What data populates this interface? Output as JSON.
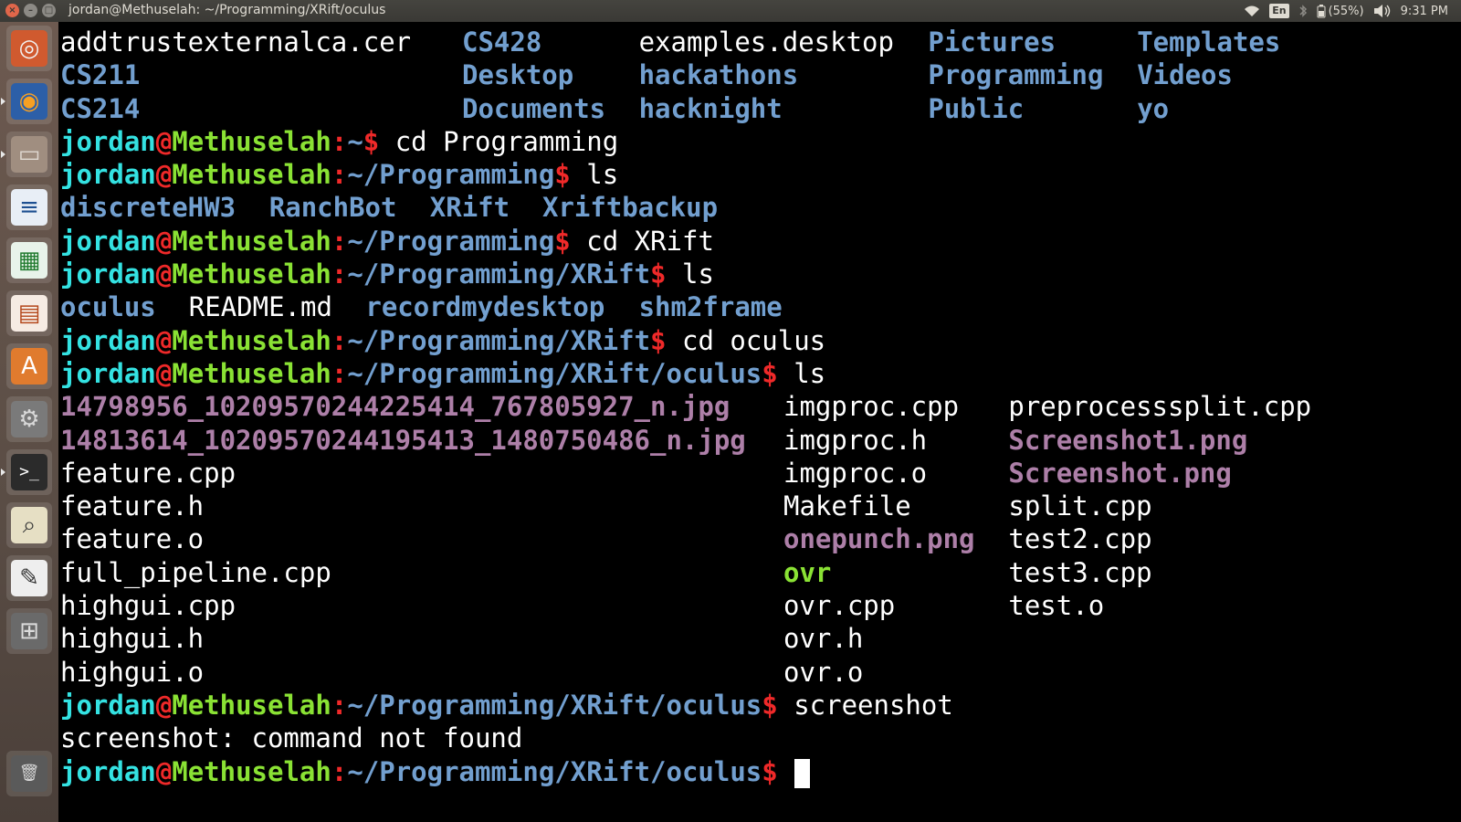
{
  "window": {
    "title": "jordan@Methuselah: ~/Programming/XRift/oculus",
    "buttons": {
      "close": "×",
      "minimize": "–",
      "maximize": "□"
    }
  },
  "indicators": {
    "wifi_icon": "wifi-icon",
    "keyboard_layout": "En",
    "bluetooth_icon": "bluetooth-icon",
    "battery_text": "(55%)",
    "volume_icon": "volume-icon",
    "clock": "9:31 PM"
  },
  "launcher": [
    {
      "name": "ubuntu-dash-icon",
      "glyph": "◎",
      "color": "#f2f2f2",
      "bg": "#d05a2f"
    },
    {
      "name": "firefox-icon",
      "glyph": "◉",
      "color": "#f7a024",
      "bg": "#2c5fa8"
    },
    {
      "name": "file-manager-icon",
      "glyph": "▭",
      "color": "#e0d9d2",
      "bg": "#a08e80"
    },
    {
      "name": "libreoffice-writer-icon",
      "glyph": "≡",
      "color": "#1d4f91",
      "bg": "#e8eef6"
    },
    {
      "name": "libreoffice-calc-icon",
      "glyph": "▦",
      "color": "#1f7a2e",
      "bg": "#e8f3ea"
    },
    {
      "name": "libreoffice-impress-icon",
      "glyph": "▤",
      "color": "#b4461a",
      "bg": "#f6ebe3"
    },
    {
      "name": "software-center-icon",
      "glyph": "A",
      "color": "#ffffff",
      "bg": "#e07b2e"
    },
    {
      "name": "system-settings-icon",
      "glyph": "⚙",
      "color": "#d8d8d8",
      "bg": "#7a7a7a"
    },
    {
      "name": "terminal-icon",
      "glyph": ">_",
      "color": "#ffffff",
      "bg": "#2b2b2b"
    },
    {
      "name": "image-viewer-icon",
      "glyph": "⌕",
      "color": "#3a3a3a",
      "bg": "#e6dfc4"
    },
    {
      "name": "text-editor-icon",
      "glyph": "✎",
      "color": "#333333",
      "bg": "#eeeeee"
    },
    {
      "name": "workspace-switcher-icon",
      "glyph": "⊞",
      "color": "#dcdcdc",
      "bg": "#6a6a6a"
    },
    {
      "name": "trash-icon",
      "glyph": "🗑",
      "color": "#d9d9d9",
      "bg": "#5a5a5a"
    }
  ],
  "prompt": {
    "user": "jordan",
    "at": "@",
    "host": "Methuselah",
    "colon": ":",
    "dollar": "$"
  },
  "terminal_lines": [
    {
      "type": "ls",
      "items": [
        {
          "text": "addtrustexternalca.cer",
          "kind": "file",
          "col": 0
        },
        {
          "text": "CS428",
          "kind": "dir",
          "col": 1
        },
        {
          "text": "examples.desktop",
          "kind": "file",
          "col": 2
        },
        {
          "text": "Pictures",
          "kind": "dir",
          "col": 3
        },
        {
          "text": "Templates",
          "kind": "dir",
          "col": 4
        }
      ]
    },
    {
      "type": "ls",
      "items": [
        {
          "text": "CS211",
          "kind": "dir",
          "col": 0
        },
        {
          "text": "Desktop",
          "kind": "dir",
          "col": 1
        },
        {
          "text": "hackathons",
          "kind": "dir",
          "col": 2
        },
        {
          "text": "Programming",
          "kind": "dir",
          "col": 3
        },
        {
          "text": "Videos",
          "kind": "dir",
          "col": 4
        }
      ]
    },
    {
      "type": "ls",
      "items": [
        {
          "text": "CS214",
          "kind": "dir",
          "col": 0
        },
        {
          "text": "Documents",
          "kind": "dir",
          "col": 1
        },
        {
          "text": "hacknight",
          "kind": "dir",
          "col": 2
        },
        {
          "text": "Public",
          "kind": "dir",
          "col": 3
        },
        {
          "text": "yo",
          "kind": "dir",
          "col": 4
        }
      ]
    },
    {
      "type": "prompt",
      "path": "~",
      "cmd": "cd Programming"
    },
    {
      "type": "prompt",
      "path": "~/Programming",
      "cmd": "ls"
    },
    {
      "type": "ls",
      "items": [
        {
          "text": "discreteHW3",
          "kind": "dir",
          "col": 0
        },
        {
          "text": "RanchBot",
          "kind": "dir",
          "col": 1
        },
        {
          "text": "XRift",
          "kind": "dir",
          "col": 2
        },
        {
          "text": "Xriftbackup",
          "kind": "dir",
          "col": 3
        }
      ]
    },
    {
      "type": "prompt",
      "path": "~/Programming",
      "cmd": "cd XRift"
    },
    {
      "type": "prompt",
      "path": "~/Programming/XRift",
      "cmd": "ls"
    },
    {
      "type": "ls",
      "items": [
        {
          "text": "oculus",
          "kind": "dir",
          "col": 0
        },
        {
          "text": "README.md",
          "kind": "file",
          "col": 1
        },
        {
          "text": "recordmydesktop",
          "kind": "dir",
          "col": 2
        },
        {
          "text": "shm2frame",
          "kind": "dir",
          "col": 3
        }
      ]
    },
    {
      "type": "prompt",
      "path": "~/Programming/XRift",
      "cmd": "cd oculus"
    },
    {
      "type": "prompt",
      "path": "~/Programming/XRift/oculus",
      "cmd": "ls"
    },
    {
      "type": "ls",
      "items": [
        {
          "text": "14798956_10209570244225414_767805927_n.jpg",
          "kind": "img",
          "col": 0
        },
        {
          "text": "imgproc.cpp",
          "kind": "file",
          "col": 1
        },
        {
          "text": "preprocesssplit.cpp",
          "kind": "file",
          "col": 2
        }
      ]
    },
    {
      "type": "ls",
      "items": [
        {
          "text": "14813614_10209570244195413_1480750486_n.jpg",
          "kind": "img",
          "col": 0
        },
        {
          "text": "imgproc.h",
          "kind": "file",
          "col": 1
        },
        {
          "text": "Screenshot1.png",
          "kind": "img",
          "col": 2
        }
      ]
    },
    {
      "type": "ls",
      "items": [
        {
          "text": "feature.cpp",
          "kind": "file",
          "col": 0
        },
        {
          "text": "imgproc.o",
          "kind": "file",
          "col": 1
        },
        {
          "text": "Screenshot.png",
          "kind": "img",
          "col": 2
        }
      ]
    },
    {
      "type": "ls",
      "items": [
        {
          "text": "feature.h",
          "kind": "file",
          "col": 0
        },
        {
          "text": "Makefile",
          "kind": "file",
          "col": 1
        },
        {
          "text": "split.cpp",
          "kind": "file",
          "col": 2
        }
      ]
    },
    {
      "type": "ls",
      "items": [
        {
          "text": "feature.o",
          "kind": "file",
          "col": 0
        },
        {
          "text": "onepunch.png",
          "kind": "img",
          "col": 1
        },
        {
          "text": "test2.cpp",
          "kind": "file",
          "col": 2
        }
      ]
    },
    {
      "type": "ls",
      "items": [
        {
          "text": "full_pipeline.cpp",
          "kind": "file",
          "col": 0
        },
        {
          "text": "ovr",
          "kind": "exe",
          "col": 1
        },
        {
          "text": "test3.cpp",
          "kind": "file",
          "col": 2
        }
      ]
    },
    {
      "type": "ls",
      "items": [
        {
          "text": "highgui.cpp",
          "kind": "file",
          "col": 0
        },
        {
          "text": "ovr.cpp",
          "kind": "file",
          "col": 1
        },
        {
          "text": "test.o",
          "kind": "file",
          "col": 2
        }
      ]
    },
    {
      "type": "ls",
      "items": [
        {
          "text": "highgui.h",
          "kind": "file",
          "col": 0
        },
        {
          "text": "ovr.h",
          "kind": "file",
          "col": 1
        }
      ]
    },
    {
      "type": "ls",
      "items": [
        {
          "text": "highgui.o",
          "kind": "file",
          "col": 0
        },
        {
          "text": "ovr.o",
          "kind": "file",
          "col": 1
        }
      ]
    },
    {
      "type": "prompt",
      "path": "~/Programming/XRift/oculus",
      "cmd": "screenshot"
    },
    {
      "type": "output",
      "text": "screenshot: command not found"
    },
    {
      "type": "prompt",
      "path": "~/Programming/XRift/oculus",
      "cmd": "",
      "cursor": true
    }
  ],
  "colors": {
    "terminal_bg": "#000000",
    "directory": "#729fcf",
    "image_file": "#ad7fa8",
    "executable": "#8ae234",
    "prompt_user": "#34e2e2",
    "prompt_at": "#ef2929",
    "prompt_host": "#8ae234",
    "prompt_path": "#729fcf"
  }
}
